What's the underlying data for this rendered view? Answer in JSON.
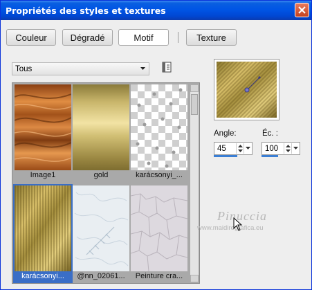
{
  "window": {
    "title": "Propriétés des styles et textures"
  },
  "tabs": [
    {
      "label": "Couleur",
      "active": false
    },
    {
      "label": "Dégradé",
      "active": false
    },
    {
      "label": "Motif",
      "active": true
    },
    {
      "label": "Texture",
      "active": false
    }
  ],
  "filter": {
    "selected": "Tous"
  },
  "patterns": [
    {
      "label": "Image1",
      "texture": "copper-marble"
    },
    {
      "label": "gold",
      "texture": "gold-brushed"
    },
    {
      "label": "karácsonyi_...",
      "texture": "checker-drops"
    },
    {
      "label": "karácsonyi...",
      "texture": "gold-weave",
      "selected": true
    },
    {
      "label": "@nn_02061...",
      "texture": "white-lace"
    },
    {
      "label": "Peinture cra...",
      "texture": "crackle-paint"
    }
  ],
  "controls": {
    "angle_label": "Angle:",
    "angle_value": "45",
    "scale_label": "Éc. :",
    "scale_value": "100"
  },
  "watermark": {
    "name": "Pinuccia",
    "url": "www.maidiregrafica.eu"
  },
  "colors": {
    "title_bar": "#0055e5",
    "selection": "#3a6ec6",
    "close_button": "#d1502e"
  }
}
